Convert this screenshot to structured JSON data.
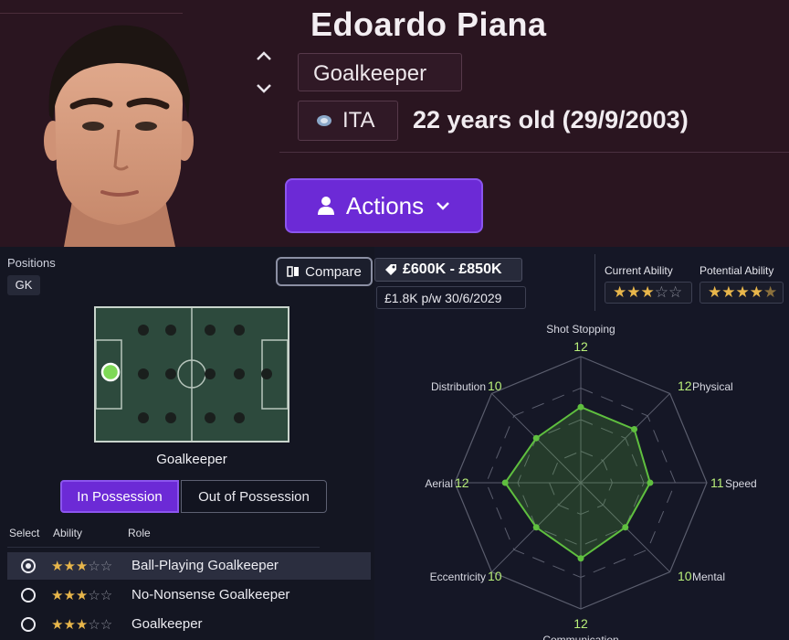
{
  "player": {
    "name": "Edoardo Piana",
    "position": "Goalkeeper",
    "nationality": "ITA",
    "age_text": "22 years old (29/9/2003)",
    "actions_label": "Actions"
  },
  "positions": {
    "label": "Positions",
    "chip": "GK",
    "compare_label": "Compare",
    "pitch_label": "Goalkeeper"
  },
  "tabs": {
    "in_possession": "In Possession",
    "out_of_possession": "Out of Possession",
    "active": "in_possession"
  },
  "roles": {
    "headers": {
      "select": "Select",
      "ability": "Ability",
      "role": "Role"
    },
    "items": [
      {
        "name": "Ball-Playing Goalkeeper",
        "stars": 3,
        "selected": true
      },
      {
        "name": "No-Nonsense Goalkeeper",
        "stars": 3,
        "selected": false
      },
      {
        "name": "Goalkeeper",
        "stars": 3,
        "selected": false
      }
    ]
  },
  "contract": {
    "value": "£600K - £850K",
    "wage": "£1.8K p/w 30/6/2029"
  },
  "ability": {
    "current_label": "Current Ability",
    "potential_label": "Potential Ability",
    "current_stars": 3,
    "potential_stars": 4.5
  },
  "attributes": {
    "labels": [
      "Shot Stopping",
      "Physical",
      "Speed",
      "Mental",
      "Communication",
      "Eccentricity",
      "Aerial",
      "Distribution"
    ],
    "values": [
      12,
      12,
      11,
      10,
      12,
      10,
      12,
      10
    ],
    "max": 20
  },
  "colors": {
    "accent": "#6c2ad6",
    "header_bg": "#2a1520",
    "pitch": "#2d4a3d",
    "player_marker": "#7ed957",
    "radar_fill": "#5fbf3f",
    "radar_value": "#b9f07a",
    "star": "#e8b64b"
  },
  "icons": {
    "chevron_up": "chevron-up-icon",
    "chevron_down": "chevron-down-icon",
    "flag": "flag-icon",
    "person": "person-icon",
    "dropdown": "chevron-down-icon",
    "compare": "compare-icon",
    "tag": "price-tag-icon"
  }
}
